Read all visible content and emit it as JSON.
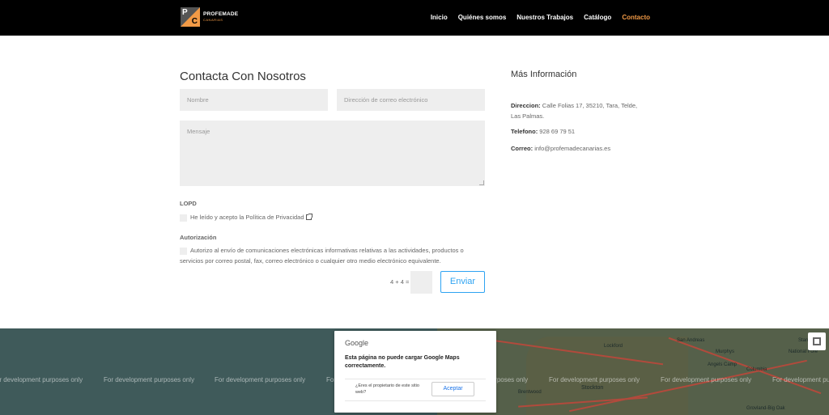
{
  "header": {
    "logo": {
      "letter_top": "P",
      "letter_bottom": "C",
      "name": "PROFEMADE",
      "tagline": "CANARIAS"
    },
    "nav": [
      {
        "label": "Inicio"
      },
      {
        "label": "Quiénes somos"
      },
      {
        "label": "Nuestros Trabajos"
      },
      {
        "label": "Catálogo"
      },
      {
        "label": "Contacto",
        "active": true
      }
    ]
  },
  "form": {
    "title": "Contacta Con Nosotros",
    "name_placeholder": "Nombre",
    "email_placeholder": "Dirección de correo electrónico",
    "message_placeholder": "Mensaje",
    "lopd_label": "LOPD",
    "lopd_text": "He leído y acepto la Política de Privacidad",
    "auth_label": "Autorización",
    "auth_text": "Autorizo al envío de comunicaciones electrónicas informativas relativas a las actividades, productos o servicios por correo postal, fax, correo electrónico o cualquier otro medio electrónico equivalente.",
    "captcha_question": "4 + 4 =",
    "submit_label": "Enviar"
  },
  "info": {
    "title": "Más Información",
    "address_label": "Direccion:",
    "address_value": "Calle Folias 17, 35210, Tara, Telde, Las Palmas.",
    "phone_label": "Telefono:",
    "phone_value": "928 69 79 51",
    "email_label": "Correo:",
    "email_value": "info@profemadecanarias.es"
  },
  "map": {
    "dev_watermark": "For development purposes only",
    "cities": [
      "Lockford",
      "Stockton",
      "Brentwood",
      "San Andreas",
      "Murphys",
      "Angels Camp",
      "Columbia",
      "National Fore",
      "Stanislaus",
      "Grovland-Big Oak"
    ],
    "dialog": {
      "brand": "Google",
      "message": "Esta página no puede cargar Google Maps correctamente.",
      "question": "¿Eres el propietario de este sitio web?",
      "ok_label": "Aceptar"
    }
  },
  "colors": {
    "accent": "#f29a46",
    "button": "#2ea3f2",
    "field_bg": "#eeeeee",
    "header_bg": "#000000"
  }
}
